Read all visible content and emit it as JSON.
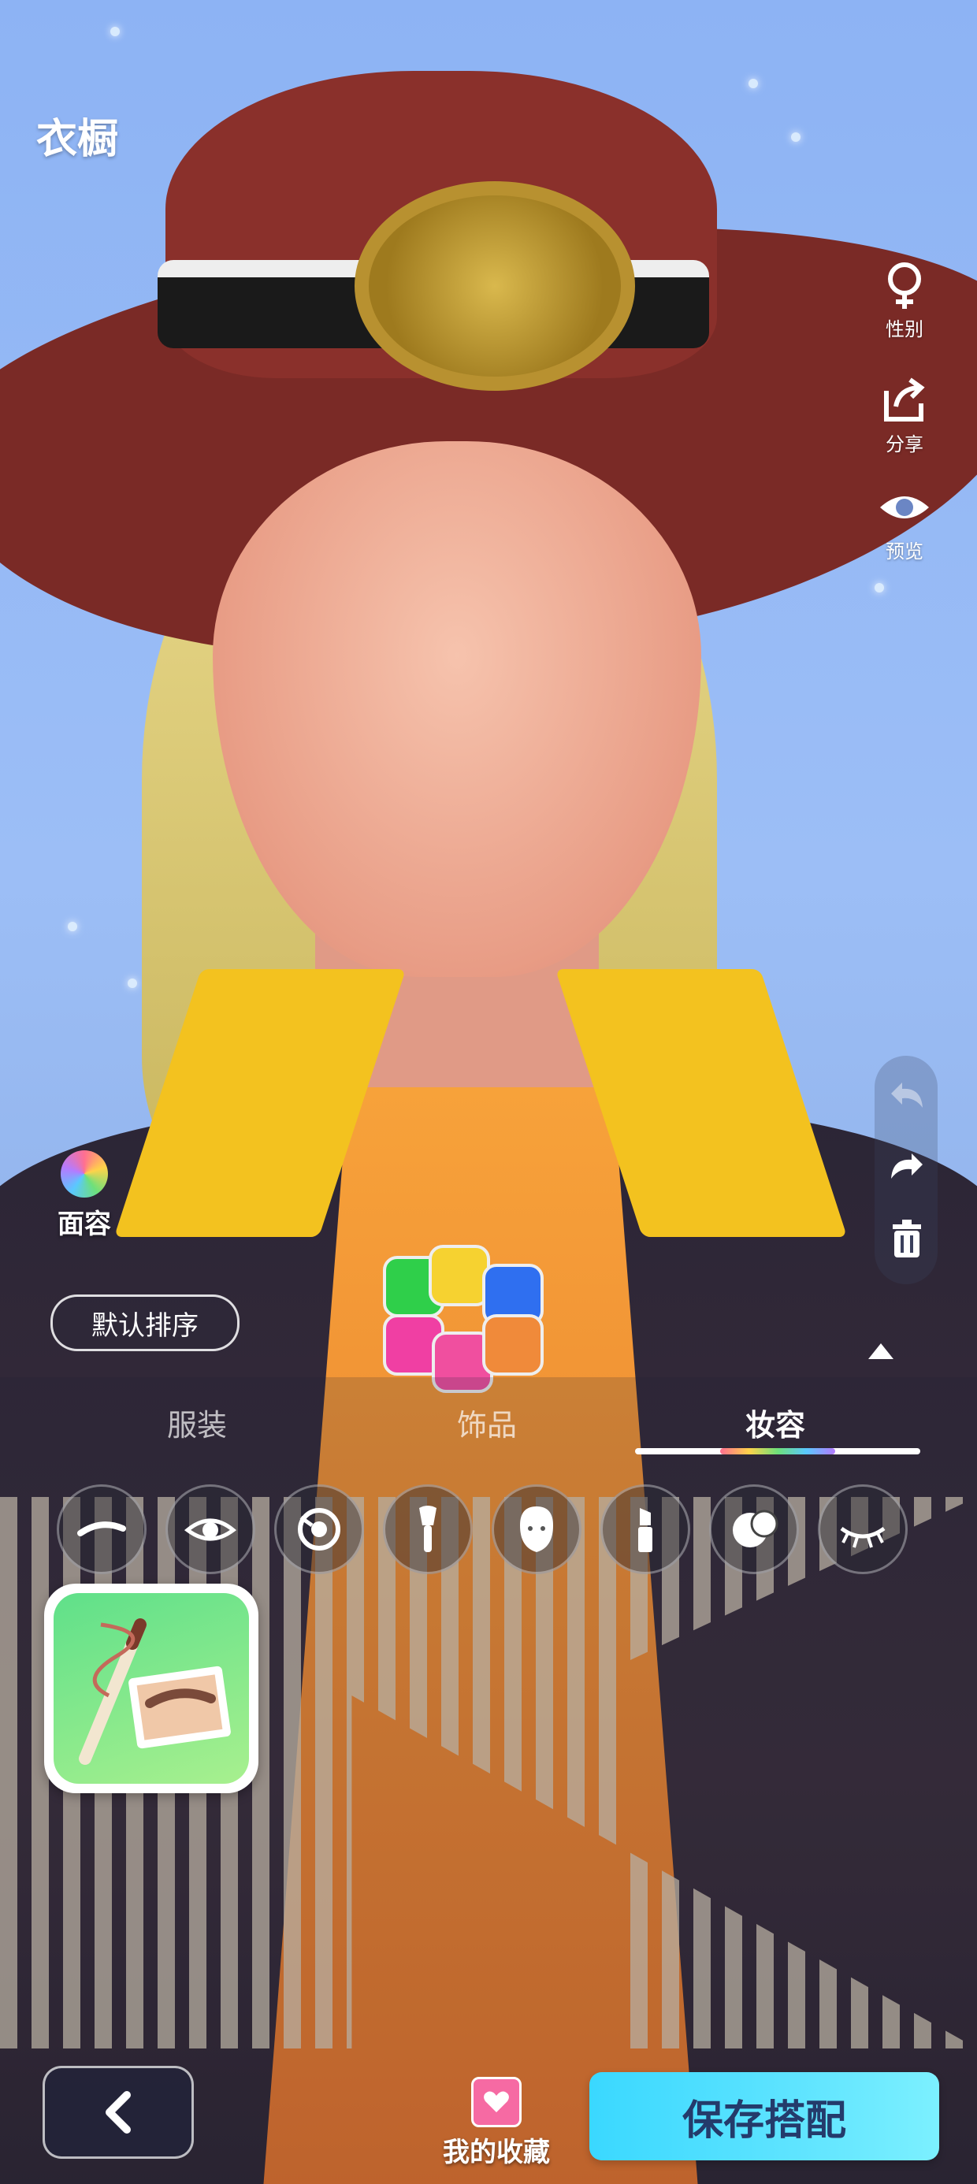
{
  "header": {
    "title": "衣橱"
  },
  "side_actions": [
    {
      "label": "性别",
      "icon": "female-icon"
    },
    {
      "label": "分享",
      "icon": "share-icon"
    },
    {
      "label": "预览",
      "icon": "eye-icon"
    }
  ],
  "edit_tools": [
    "undo-icon",
    "redo-icon",
    "trash-icon"
  ],
  "face_button": {
    "label": "面容"
  },
  "sort_button": {
    "label": "默认排序"
  },
  "tabs": [
    {
      "label": "服装",
      "active": false
    },
    {
      "label": "饰品",
      "active": false
    },
    {
      "label": "妆容",
      "active": true
    }
  ],
  "makeup_categories": [
    "eyebrow-icon",
    "eye-icon",
    "eye-color-icon",
    "brush-icon",
    "face-icon",
    "lipstick-icon",
    "face-paint-icon",
    "eyelash-icon"
  ],
  "bottom": {
    "favorites_label": "我的收藏",
    "save_label": "保存搭配"
  },
  "colors": {
    "sky": "#8db3f4",
    "save_button": "#3ad8ff",
    "save_text": "#243b6b",
    "favorite_heart": "#f66aa3"
  }
}
